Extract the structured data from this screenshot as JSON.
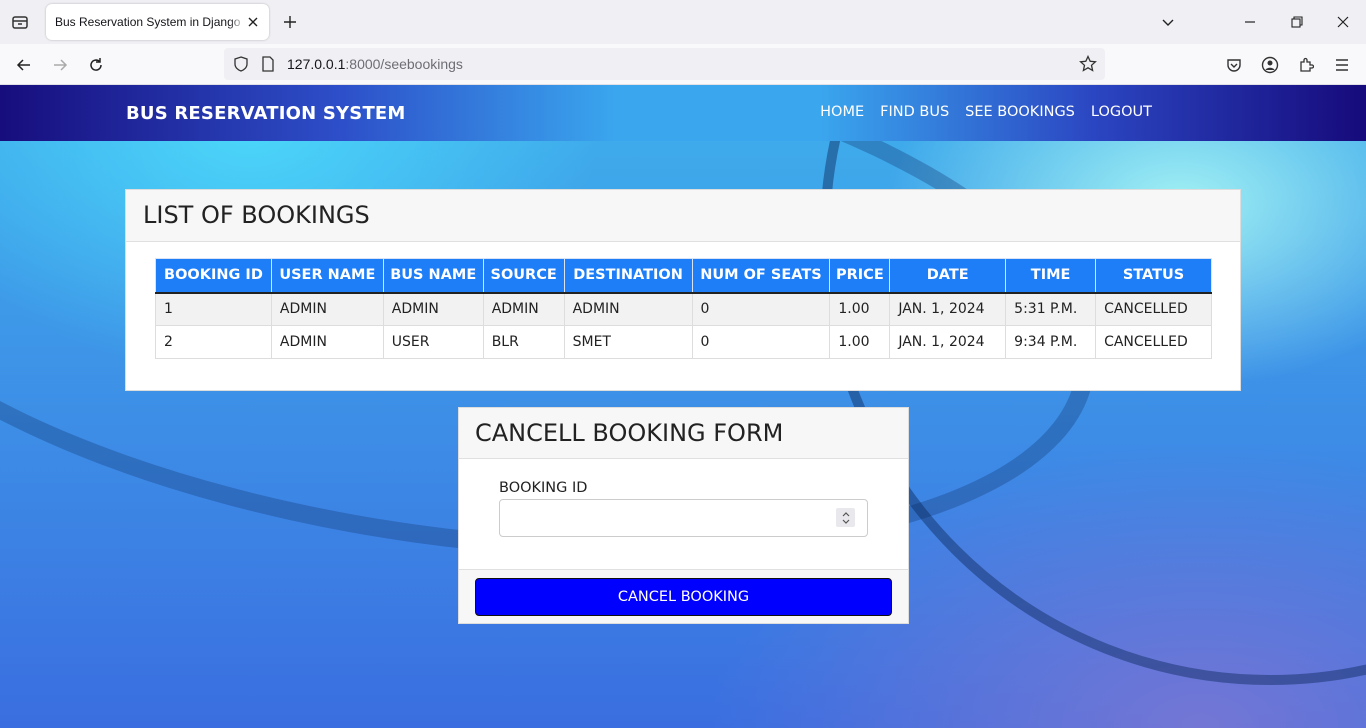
{
  "browser": {
    "tab_title": "Bus Reservation System in Django P",
    "url_host": "127.0.0.1",
    "url_path": ":8000/seebookings"
  },
  "site": {
    "brand": "BUS RESERVATION SYSTEM",
    "menu": [
      "HOME",
      "FIND BUS",
      "SEE BOOKINGS",
      "LOGOUT"
    ]
  },
  "bookings": {
    "title": "LIST OF BOOKINGS",
    "columns": [
      "BOOKING ID",
      "USER NAME",
      "BUS NAME",
      "SOURCE",
      "DESTINATION",
      "NUM OF SEATS",
      "PRICE",
      "DATE",
      "TIME",
      "STATUS"
    ],
    "rows": [
      [
        "1",
        "ADMIN",
        "ADMIN",
        "ADMIN",
        "ADMIN",
        "0",
        "1.00",
        "JAN. 1, 2024",
        "5:31 P.M.",
        "CANCELLED"
      ],
      [
        "2",
        "ADMIN",
        "USER",
        "BLR",
        "SMET",
        "0",
        "1.00",
        "JAN. 1, 2024",
        "9:34 P.M.",
        "CANCELLED"
      ]
    ]
  },
  "cancel_form": {
    "title": "CANCELL BOOKING FORM",
    "field_label": "BOOKING ID",
    "field_value": "",
    "button_label": "CANCEL BOOKING"
  }
}
